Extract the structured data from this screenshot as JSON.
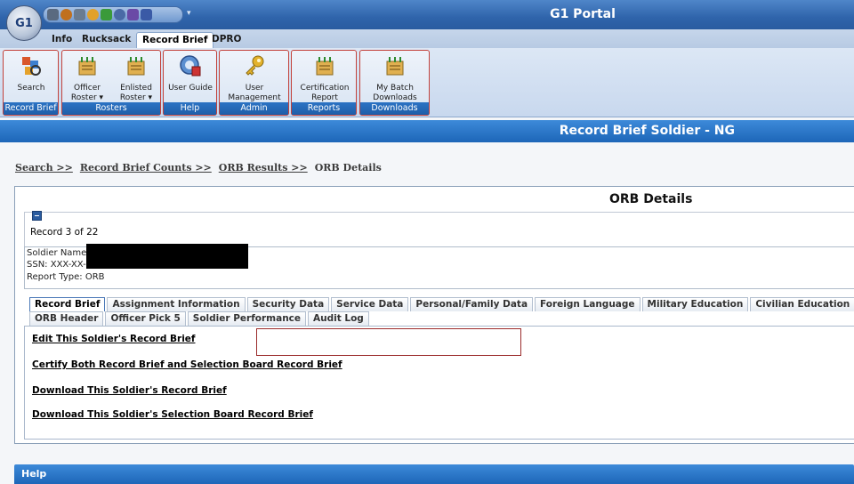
{
  "window": {
    "title": "G1 Portal",
    "app_logo": "G1"
  },
  "quick_access": {
    "icons": [
      {
        "name": "print-icon",
        "color": "#5a6a80"
      },
      {
        "name": "globe-icon",
        "color": "#c0701e"
      },
      {
        "name": "tools-icon",
        "color": "#6a7c91"
      },
      {
        "name": "search-icon",
        "color": "#e1a12a"
      },
      {
        "name": "record-icon",
        "color": "#3a9a3a"
      },
      {
        "name": "clock-icon",
        "color": "#4a6aa6"
      },
      {
        "name": "form-icon",
        "color": "#6a4aa6"
      },
      {
        "name": "batch-icon",
        "color": "#3a5aa6"
      }
    ]
  },
  "ribbon_tabs": [
    "Info",
    "Rucksack",
    "Record Brief",
    "DPRO"
  ],
  "ribbon_active_tab": "Record Brief",
  "ribbon_groups": [
    {
      "label": "Record Brief",
      "buttons": [
        {
          "label": "Search",
          "icon": "search-soldier-icon"
        }
      ]
    },
    {
      "label": "Rosters",
      "buttons": [
        {
          "label": "Officer\nRoster ▾",
          "icon": "roster-icon"
        },
        {
          "label": "Enlisted\nRoster ▾",
          "icon": "roster-icon"
        }
      ]
    },
    {
      "label": "Help",
      "buttons": [
        {
          "label": "User Guide",
          "icon": "user-guide-icon"
        }
      ]
    },
    {
      "label": "Admin",
      "buttons": [
        {
          "label": "User\nManagement",
          "icon": "key-icon"
        }
      ]
    },
    {
      "label": "Reports",
      "buttons": [
        {
          "label": "Certification\nReport",
          "icon": "report-icon"
        }
      ]
    },
    {
      "label": "Downloads",
      "buttons": [
        {
          "label": "My Batch\nDownloads",
          "icon": "download-icon"
        }
      ]
    }
  ],
  "section": {
    "title": "Record Brief Soldier - NG"
  },
  "breadcrumb": {
    "links": [
      "Search >>",
      "Record Brief Counts >>",
      "ORB Results >>"
    ],
    "current": "ORB Details"
  },
  "panel": {
    "title": "ORB Details",
    "record_count": "Record 3 of 22",
    "soldier_name_label": "Soldier Name",
    "ssn_label": "SSN: XXX-XX-",
    "report_type": "Report Type: ORB"
  },
  "content_tabs_row1": [
    "Record Brief",
    "Assignment Information",
    "Security Data",
    "Service Data",
    "Personal/Family Data",
    "Foreign Language",
    "Military Education",
    "Civilian Education"
  ],
  "content_tabs_row2": [
    "ORB Header",
    "Officer Pick 5",
    "Soldier Performance",
    "Audit Log"
  ],
  "content_active_tab": "Record Brief",
  "actions": [
    "Edit This Soldier's Record Brief",
    "Certify Both Record Brief and Selection Board Record Brief",
    "Download This Soldier's Record Brief",
    "Download This Soldier's Selection Board Record Brief"
  ],
  "help_bar": {
    "label": "Help"
  },
  "colors": {
    "title_bar": "#2f64ab",
    "section_bar": "#1d66b8",
    "group_border": "#c3423b",
    "group_label": "#1f5ea8"
  }
}
